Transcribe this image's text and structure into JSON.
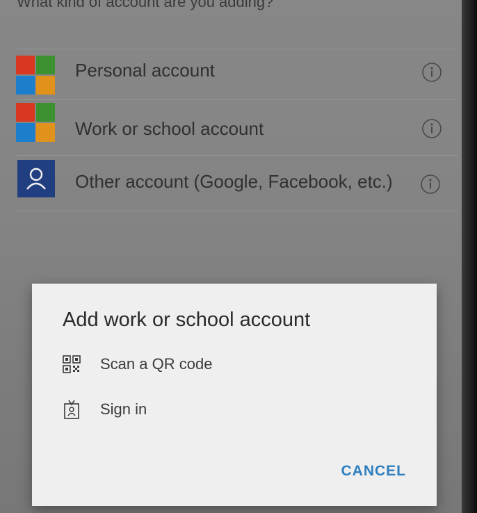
{
  "prompt": "What kind of account are you adding?",
  "accounts": [
    {
      "label": "Personal account",
      "icon": "microsoft-logo"
    },
    {
      "label": "Work or school account",
      "icon": "microsoft-logo"
    },
    {
      "label": "Other account (Google, Facebook, etc.)",
      "icon": "user-icon"
    }
  ],
  "info_icon": "info-icon",
  "dialog": {
    "title": "Add work or school account",
    "options": [
      {
        "label": "Scan a QR code",
        "icon": "qr-code-icon"
      },
      {
        "label": "Sign in",
        "icon": "badge-icon"
      }
    ],
    "cancel_label": "CANCEL"
  },
  "colors": {
    "ms_red": "#e4381d",
    "ms_green": "#3c9a2e",
    "ms_blue": "#1b84d7",
    "ms_yellow": "#ef9a17",
    "user_tile": "#1f3f86",
    "accent": "#2f7fbf"
  }
}
